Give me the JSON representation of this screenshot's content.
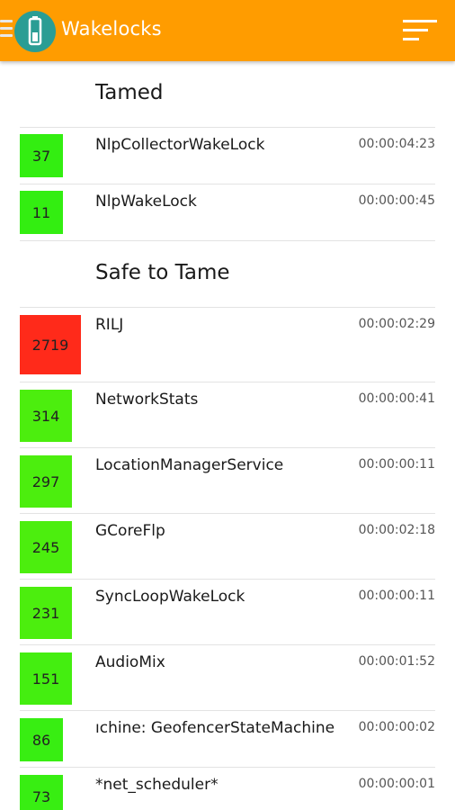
{
  "appbar": {
    "title": "Wakelocks",
    "background": "#ff9c00",
    "logo_icon": "battery-icon",
    "sort_icon": "sort-icon"
  },
  "sections": [
    {
      "title": "Tamed",
      "items": [
        {
          "count": "37",
          "name": "NlpCollectorWakeLock",
          "time": "00:00:04:23",
          "color": "#33ee11"
        },
        {
          "count": "11",
          "name": "NlpWakeLock",
          "time": "00:00:00:45",
          "color": "#33ee11"
        }
      ]
    },
    {
      "title": "Safe to Tame",
      "items": [
        {
          "count": "2719",
          "name": "RILJ",
          "time": "00:00:02:29",
          "color": "#ff2a1a"
        },
        {
          "count": "314",
          "name": "NetworkStats",
          "time": "00:00:00:41",
          "color": "#4cee0e"
        },
        {
          "count": "297",
          "name": "LocationManagerService",
          "time": "00:00:00:11",
          "color": "#4cee0e"
        },
        {
          "count": "245",
          "name": "GCoreFlp",
          "time": "00:00:02:18",
          "color": "#4cee0e"
        },
        {
          "count": "231",
          "name": "SyncLoopWakeLock",
          "time": "00:00:00:11",
          "color": "#4cee0e"
        },
        {
          "count": "151",
          "name": "AudioMix",
          "time": "00:00:01:52",
          "color": "#44ee10"
        },
        {
          "count": "86",
          "name": "ıchine: GeofencerStateMachine",
          "time": "00:00:00:02",
          "color": "#38ee12"
        },
        {
          "count": "73",
          "name": "*net_scheduler*",
          "time": "00:00:00:01",
          "color": "#38ee12"
        }
      ]
    }
  ]
}
